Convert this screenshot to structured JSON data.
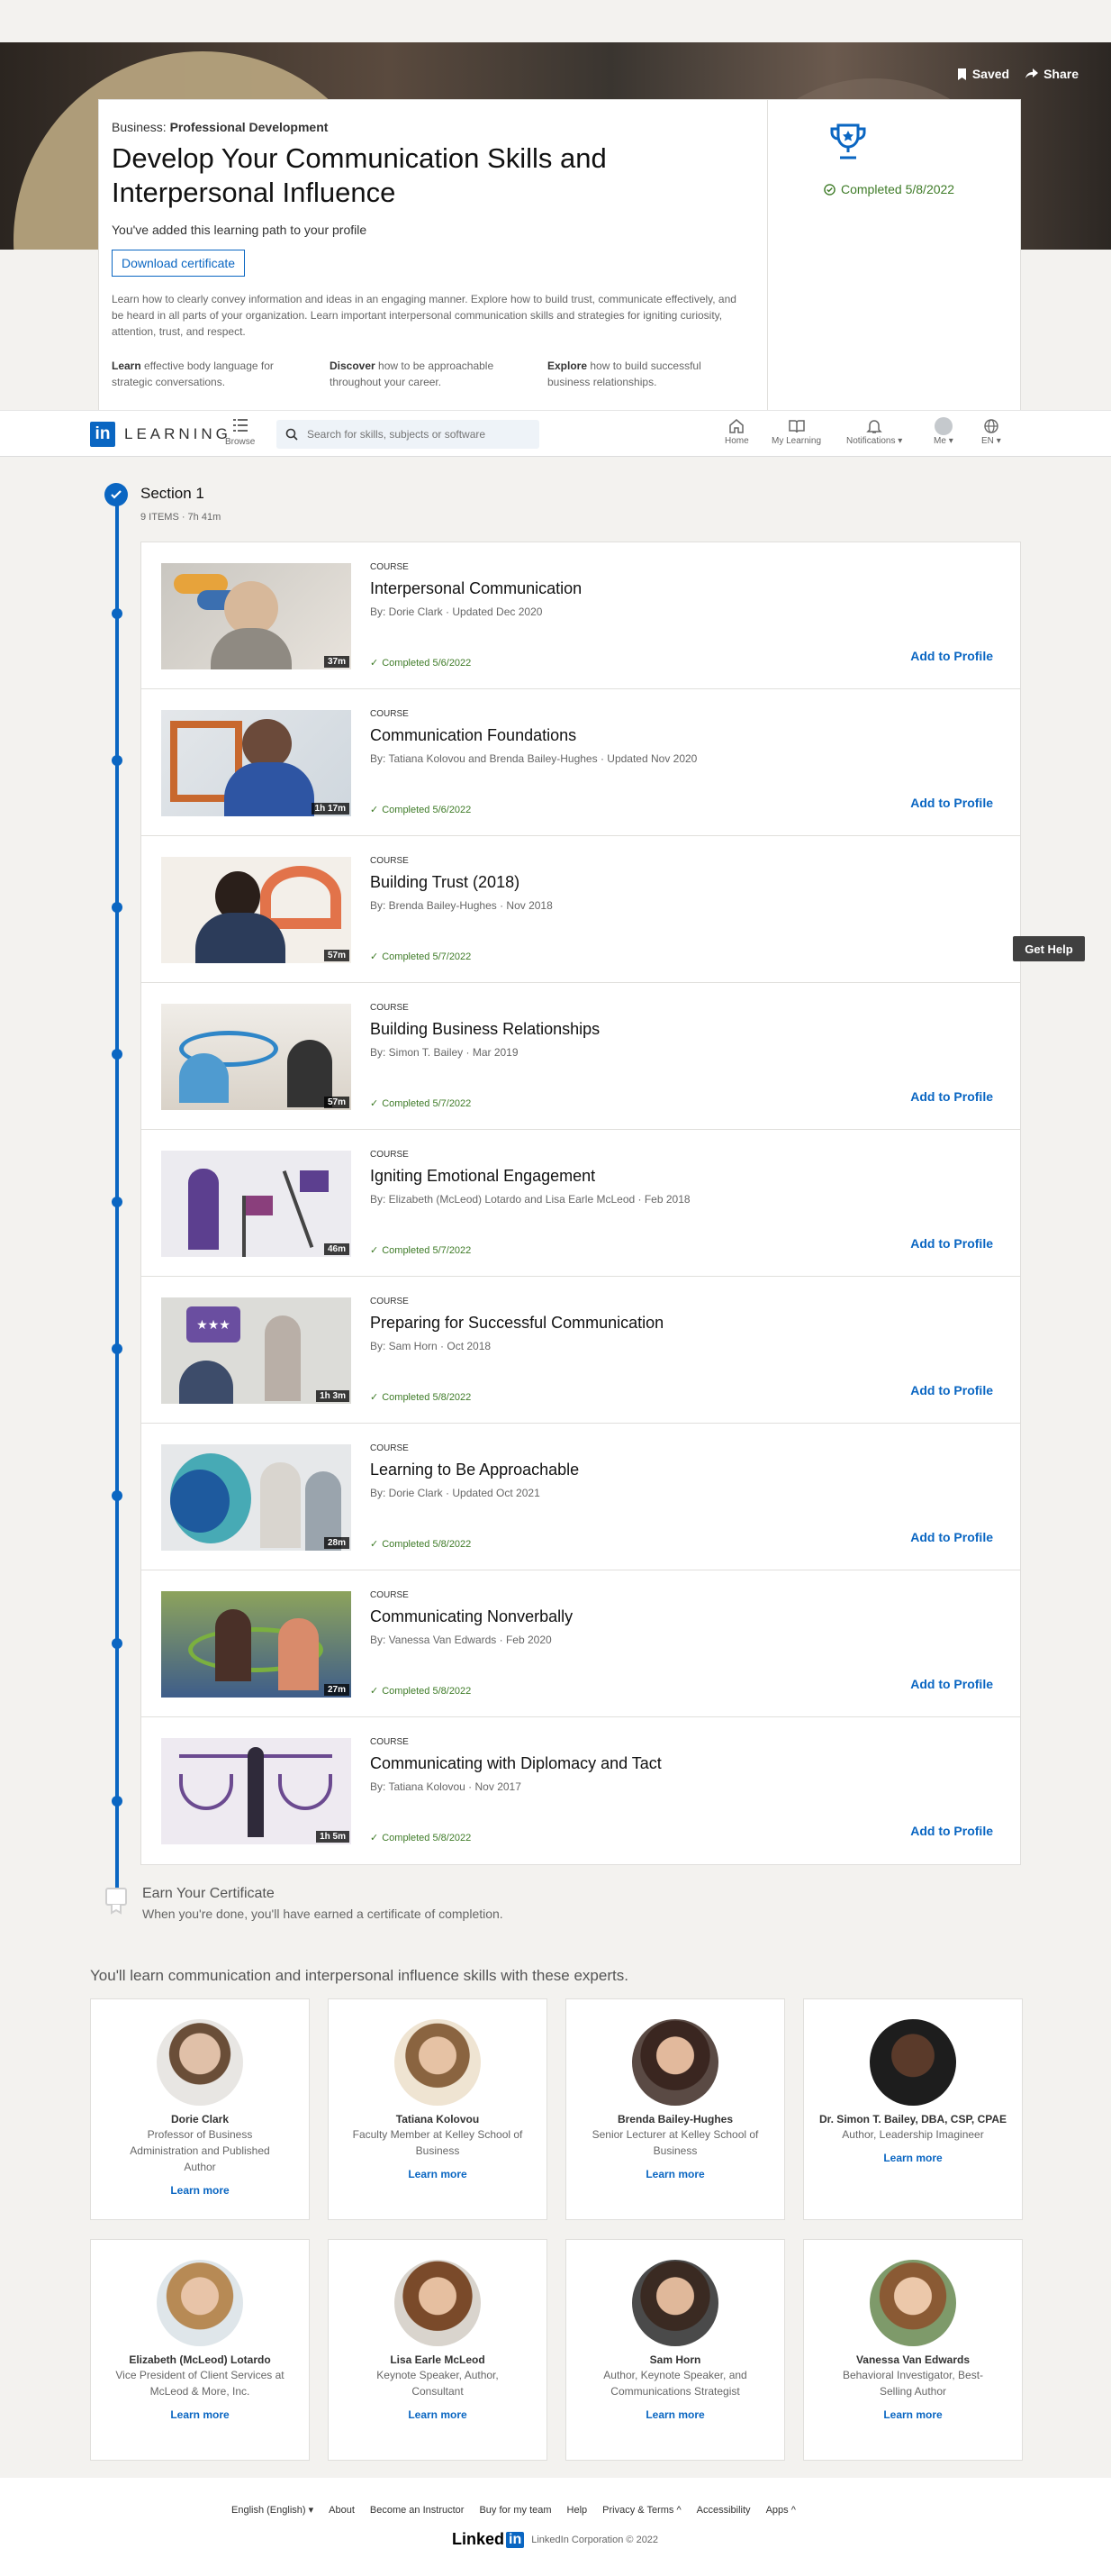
{
  "hero": {
    "saved_label": "Saved",
    "share_label": "Share",
    "kicker_prefix": "Business:",
    "kicker_topic": "Professional Development",
    "title": "Develop Your Communication Skills and Interpersonal Influence",
    "added_text": "You've added this learning path to your profile",
    "download_label": "Download certificate",
    "description": "Learn how to clearly convey information and ideas in an engaging manner. Explore how to build trust, communicate effectively, and be heard in all parts of your organization. Learn important interpersonal communication skills and strategies for igniting curiosity, attention, trust, and respect.",
    "learns": [
      {
        "verb": "Learn",
        "rest": "effective body language for strategic conversations."
      },
      {
        "verb": "Discover",
        "rest": "how to be approachable throughout your career."
      },
      {
        "verb": "Explore",
        "rest": "how to build successful business relationships."
      }
    ],
    "completed": "Completed 5/8/2022"
  },
  "nav": {
    "logo_word": "LEARNING",
    "browse": "Browse",
    "search_placeholder": "Search for skills, subjects or software",
    "home": "Home",
    "my_learning": "My Learning",
    "notifications": "Notifications",
    "me": "Me",
    "lang": "EN"
  },
  "section": {
    "title": "Section 1",
    "meta": "9 ITEMS  ·  7h 41m",
    "type_label": "COURSE",
    "add_label": "Add to Profile",
    "courses": [
      {
        "title": "Interpersonal Communication",
        "by": "By: Dorie Clark  ·  Updated Dec 2020",
        "done": "Completed 5/6/2022",
        "dur": "37m",
        "add": true
      },
      {
        "title": "Communication Foundations",
        "by": "By: Tatiana Kolovou and Brenda Bailey-Hughes  ·  Updated Nov 2020",
        "done": "Completed 5/6/2022",
        "dur": "1h 17m",
        "add": true
      },
      {
        "title": "Building Trust (2018)",
        "by": "By: Brenda Bailey-Hughes  ·  Nov 2018",
        "done": "Completed 5/7/2022",
        "dur": "57m",
        "add": false
      },
      {
        "title": "Building Business Relationships",
        "by": "By: Simon T. Bailey  ·  Mar 2019",
        "done": "Completed 5/7/2022",
        "dur": "57m",
        "add": true
      },
      {
        "title": "Igniting Emotional Engagement",
        "by": "By: Elizabeth (McLeod) Lotardo and Lisa Earle McLeod  ·  Feb 2018",
        "done": "Completed 5/7/2022",
        "dur": "46m",
        "add": true
      },
      {
        "title": "Preparing for Successful Communication",
        "by": "By: Sam Horn  ·  Oct 2018",
        "done": "Completed 5/8/2022",
        "dur": "1h 3m",
        "add": true
      },
      {
        "title": "Learning to Be Approachable",
        "by": "By: Dorie Clark  ·  Updated Oct 2021",
        "done": "Completed 5/8/2022",
        "dur": "28m",
        "add": true
      },
      {
        "title": "Communicating Nonverbally",
        "by": "By: Vanessa Van Edwards  ·  Feb 2020",
        "done": "Completed 5/8/2022",
        "dur": "27m",
        "add": true
      },
      {
        "title": "Communicating with Diplomacy and Tact",
        "by": "By: Tatiana Kolovou  ·  Nov 2017",
        "done": "Completed 5/8/2022",
        "dur": "1h 5m",
        "add": true
      }
    ]
  },
  "get_help": "Get Help",
  "certificate": {
    "title": "Earn Your Certificate",
    "subtitle": "When you're done, you'll have earned a certificate of completion."
  },
  "experts": {
    "heading": "You'll learn communication and interpersonal influence skills with these experts.",
    "learn_more": "Learn more",
    "people": [
      {
        "name": "Dorie Clark",
        "role": "Professor of Business Administration and Published Author"
      },
      {
        "name": "Tatiana Kolovou",
        "role": "Faculty Member at Kelley School of Business"
      },
      {
        "name": "Brenda Bailey-Hughes",
        "role": "Senior Lecturer at Kelley School of Business"
      },
      {
        "name": "Dr. Simon T. Bailey, DBA, CSP, CPAE",
        "role": "Author, Leadership Imagineer"
      },
      {
        "name": "Elizabeth (McLeod) Lotardo",
        "role": "Vice President of Client Services at McLeod & More, Inc."
      },
      {
        "name": "Lisa Earle McLeod",
        "role": "Keynote Speaker, Author, Consultant"
      },
      {
        "name": "Sam Horn",
        "role": "Author, Keynote Speaker, and Communications Strategist"
      },
      {
        "name": "Vanessa Van Edwards",
        "role": "Behavioral Investigator, Best-Selling Author"
      }
    ]
  },
  "footer": {
    "language": "English (English)",
    "links": [
      "About",
      "Become an Instructor",
      "Buy for my team",
      "Help",
      "Privacy & Terms",
      "Accessibility",
      "Apps"
    ],
    "logo_text": "Linked",
    "logo_in": "in",
    "copyright": "LinkedIn Corporation © 2022"
  },
  "colors": {
    "accent": "#0a66c2",
    "success": "#3e7b27",
    "background": "#f3f2ef"
  }
}
